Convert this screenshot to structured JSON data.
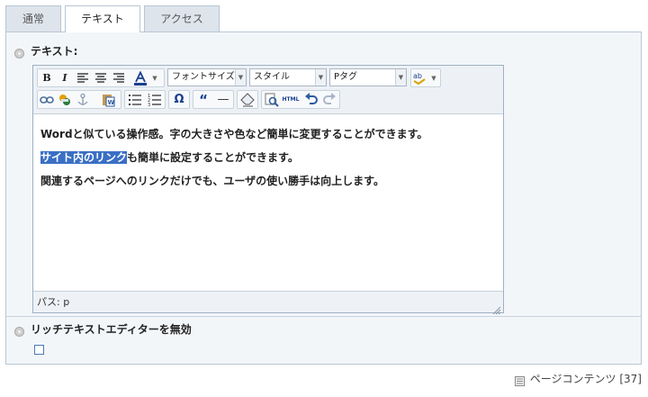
{
  "tabs": [
    {
      "label": "通常",
      "active": false
    },
    {
      "label": "テキスト",
      "active": true
    },
    {
      "label": "アクセス",
      "active": false
    }
  ],
  "text_field": {
    "label": "テキスト:"
  },
  "toolbar": {
    "font_size_select": "フォントサイズ",
    "style_select": "スタイル",
    "format_select": "Pタグ",
    "bold": "B",
    "italic": "I",
    "omega": "Ω",
    "blockquote": "“",
    "hr": "—",
    "html_button": "HTML"
  },
  "editor": {
    "lines": [
      {
        "text": "Wordと似ている操作感。字の大きさや色など簡単に変更することができます。"
      },
      {
        "highlight": "サイト内のリンク",
        "rest": "も簡単に設定することができます。"
      },
      {
        "text": "関連するページへのリンクだけでも、ユーザの使い勝手は向上します。"
      }
    ],
    "status_path": "パス: p"
  },
  "rte_toggle": {
    "label": "リッチテキストエディターを無効",
    "checked": false
  },
  "footer": {
    "label": "ページコンテンツ [37]"
  },
  "colors": {
    "accent": "#3a6fc4",
    "panel_bg": "#f3f6f9",
    "tab_bg": "#dde4ec",
    "border": "#b8c6d4"
  },
  "icons": [
    "bold-icon",
    "italic-icon",
    "align-left-icon",
    "align-center-icon",
    "align-right-icon",
    "font-color-icon",
    "spellcheck-icon",
    "link-icon",
    "unlink-icon",
    "anchor-icon",
    "paste-word-icon",
    "bullet-list-icon",
    "numbered-list-icon",
    "special-char-icon",
    "blockquote-icon",
    "horizontal-rule-icon",
    "remove-format-icon",
    "find-replace-icon",
    "html-source-icon",
    "undo-icon",
    "redo-icon",
    "page-content-icon"
  ]
}
